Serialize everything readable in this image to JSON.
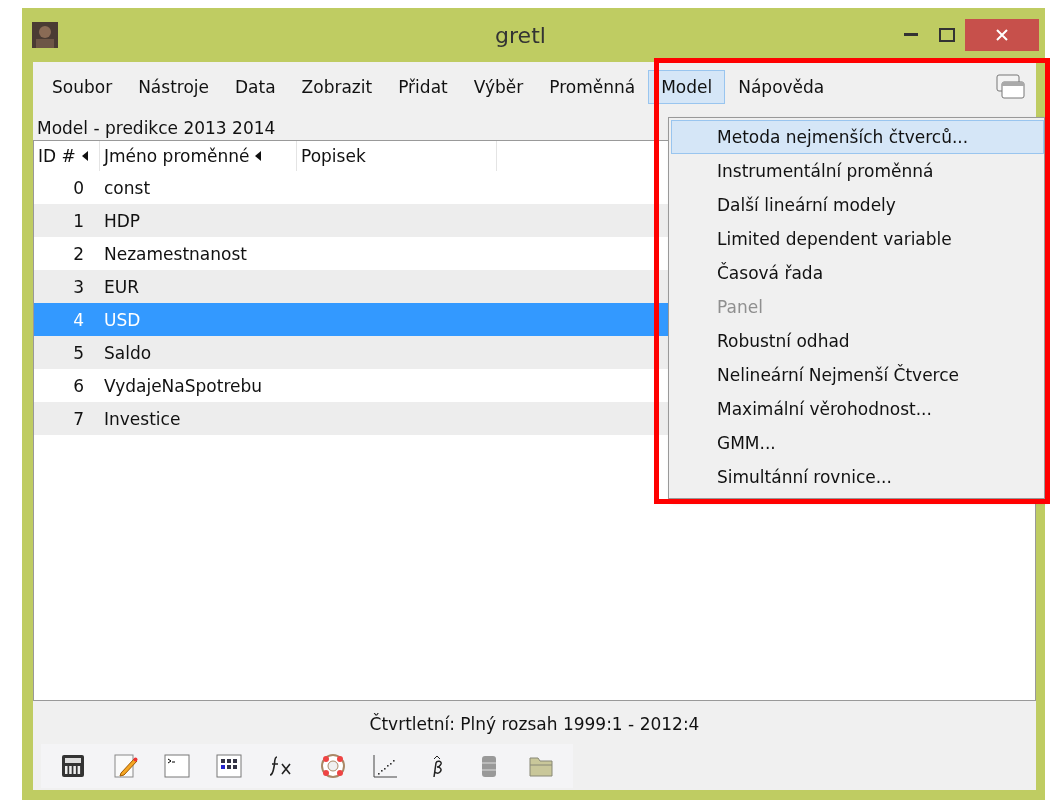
{
  "window": {
    "title": "gretl"
  },
  "menubar": [
    {
      "label": "Soubor",
      "selected": false
    },
    {
      "label": "Nástroje",
      "selected": false
    },
    {
      "label": "Data",
      "selected": false
    },
    {
      "label": "Zobrazit",
      "selected": false
    },
    {
      "label": "Přidat",
      "selected": false
    },
    {
      "label": "Výběr",
      "selected": false
    },
    {
      "label": "Proměnná",
      "selected": false
    },
    {
      "label": "Model",
      "selected": true
    },
    {
      "label": "Nápověda",
      "selected": false
    }
  ],
  "dataset_label": "Model - predikce 2013 2014",
  "table": {
    "columns": [
      "ID #",
      "Jméno proměnné",
      "Popisek"
    ],
    "rows": [
      {
        "id": "0",
        "name": "const",
        "selected": false
      },
      {
        "id": "1",
        "name": "HDP",
        "selected": false
      },
      {
        "id": "2",
        "name": "Nezamestnanost",
        "selected": false
      },
      {
        "id": "3",
        "name": "EUR",
        "selected": false
      },
      {
        "id": "4",
        "name": "USD",
        "selected": true
      },
      {
        "id": "5",
        "name": "Saldo",
        "selected": false
      },
      {
        "id": "6",
        "name": "VydajeNaSpotrebu",
        "selected": false
      },
      {
        "id": "7",
        "name": "Investice",
        "selected": false
      }
    ]
  },
  "model_menu": [
    {
      "label": "Metoda nejmenších čtverců...",
      "selected": true,
      "disabled": false
    },
    {
      "label": "Instrumentální proměnná",
      "selected": false,
      "disabled": false
    },
    {
      "label": "Další lineární modely",
      "selected": false,
      "disabled": false
    },
    {
      "label": "Limited dependent variable",
      "selected": false,
      "disabled": false
    },
    {
      "label": "Časová řada",
      "selected": false,
      "disabled": false
    },
    {
      "label": "Panel",
      "selected": false,
      "disabled": true
    },
    {
      "label": "Robustní odhad",
      "selected": false,
      "disabled": false
    },
    {
      "label": "Nelineární Nejmenší Čtverce",
      "selected": false,
      "disabled": false
    },
    {
      "label": "Maximální věrohodnost...",
      "selected": false,
      "disabled": false
    },
    {
      "label": "GMM...",
      "selected": false,
      "disabled": false
    },
    {
      "label": "Simultánní rovnice...",
      "selected": false,
      "disabled": false
    }
  ],
  "status_bar": "Čtvrtletní: Plný rozsah 1999:1 - 2012:4",
  "toolbar": [
    {
      "kind": "calculator"
    },
    {
      "kind": "notepad"
    },
    {
      "kind": "terminal"
    },
    {
      "kind": "session"
    },
    {
      "kind": "function"
    },
    {
      "kind": "help"
    },
    {
      "kind": "scatter"
    },
    {
      "kind": "beta"
    },
    {
      "kind": "database"
    },
    {
      "kind": "folder"
    }
  ]
}
